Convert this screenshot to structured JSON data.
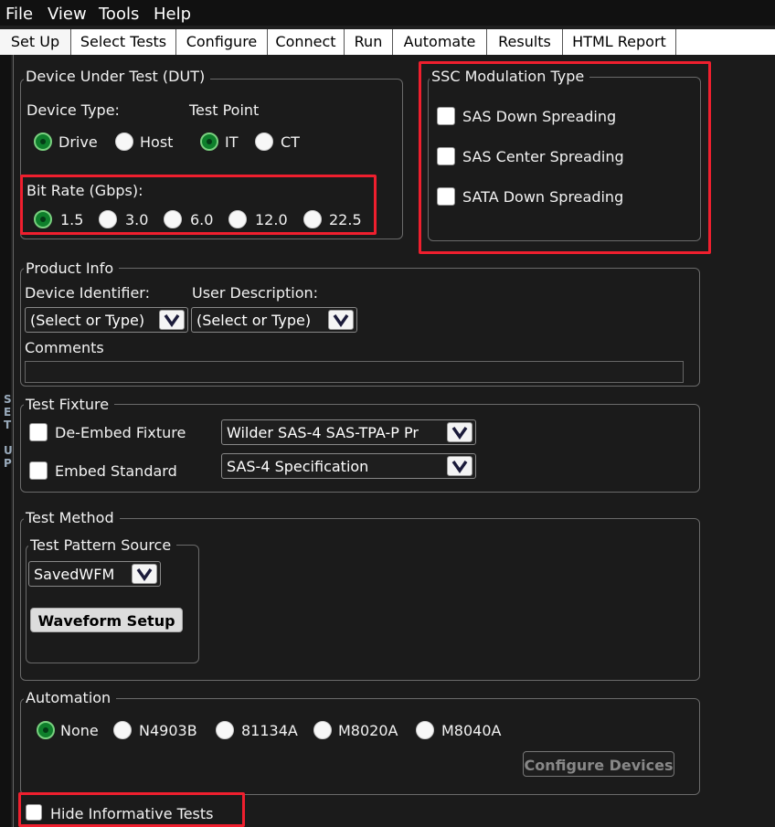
{
  "menu": [
    "File",
    "View",
    "Tools",
    "Help"
  ],
  "tabs": [
    "Set Up",
    "Select Tests",
    "Configure",
    "Connect",
    "Run",
    "Automate",
    "Results",
    "HTML Report"
  ],
  "sidebar_label": "SET UP",
  "dut": {
    "title": "Device Under Test (DUT)",
    "device_type_label": "Device Type:",
    "test_point_label": "Test Point",
    "device_options": [
      "Drive",
      "Host"
    ],
    "test_point_options": [
      "IT",
      "CT"
    ],
    "bit_rate_label": "Bit Rate (Gbps):",
    "bit_rates": [
      "1.5",
      "3.0",
      "6.0",
      "12.0",
      "22.5"
    ]
  },
  "ssc": {
    "title": "SSC Modulation Type",
    "options": [
      "SAS Down Spreading",
      "SAS Center Spreading",
      "SATA Down Spreading"
    ]
  },
  "product": {
    "title": "Product Info",
    "device_id_label": "Device Identifier:",
    "user_desc_label": "User Description:",
    "device_id_value": "(Select or Type)",
    "user_desc_value": "(Select or Type)",
    "comments_label": "Comments",
    "comments_value": ""
  },
  "fixture": {
    "title": "Test Fixture",
    "deembed_label": "De-Embed Fixture",
    "deembed_value": "Wilder SAS-4 SAS-TPA-P Pr",
    "embed_label": "Embed Standard",
    "embed_value": "SAS-4 Specification"
  },
  "method": {
    "title": "Test Method",
    "pattern_source_title": "Test Pattern Source",
    "pattern_source_value": "SavedWFM",
    "waveform_button": "Waveform Setup"
  },
  "automation": {
    "title": "Automation",
    "options": [
      "None",
      "N4903B",
      "81134A",
      "M8020A",
      "M8040A"
    ],
    "configure_button": "Configure Devices"
  },
  "hide_informative": "Hide Informative Tests",
  "colors": {
    "highlight": "#ef1f2e",
    "radio_selected": "#0e7f2b"
  }
}
